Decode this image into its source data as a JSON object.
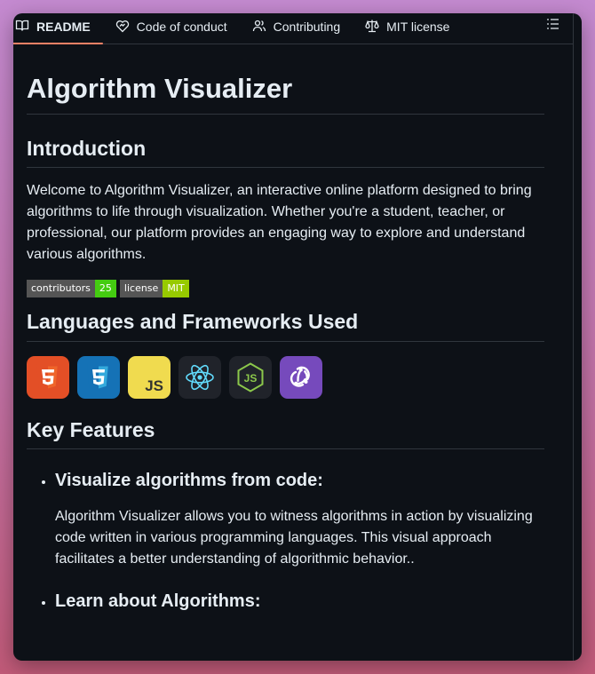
{
  "tabs": [
    {
      "label": "README",
      "icon": "book-icon",
      "active": true
    },
    {
      "label": "Code of conduct",
      "icon": "code-of-conduct-icon",
      "active": false
    },
    {
      "label": "Contributing",
      "icon": "people-icon",
      "active": false
    },
    {
      "label": "MIT license",
      "icon": "law-icon",
      "active": false
    }
  ],
  "readme": {
    "title": "Algorithm Visualizer",
    "intro_heading": "Introduction",
    "intro_text": "Welcome to Algorithm Visualizer, an interactive online platform designed to bring algorithms to life through visualization. Whether you're a student, teacher, or professional, our platform provides an engaging way to explore and understand various algorithms.",
    "badges": [
      {
        "label": "contributors",
        "value": "25",
        "color": "#4c1"
      },
      {
        "label": "license",
        "value": "MIT",
        "color": "#97ca00"
      }
    ],
    "languages_heading": "Languages and Frameworks Used",
    "technologies": [
      {
        "name": "html5-icon",
        "color": "#e34f26"
      },
      {
        "name": "css3-icon",
        "color": "#1572b6"
      },
      {
        "name": "javascript-icon",
        "color": "#f0db4f"
      },
      {
        "name": "react-icon",
        "color": "#20232a"
      },
      {
        "name": "nodejs-icon",
        "color": "#20232a"
      },
      {
        "name": "redux-icon",
        "color": "#764abc"
      }
    ],
    "features_heading": "Key Features",
    "features": [
      {
        "title": "Visualize algorithms from code:",
        "text": "Algorithm Visualizer allows you to witness algorithms in action by visualizing code written in various programming languages. This visual approach facilitates a better understanding of algorithmic behavior.."
      },
      {
        "title": "Learn about Algorithms:",
        "text": ""
      }
    ]
  }
}
